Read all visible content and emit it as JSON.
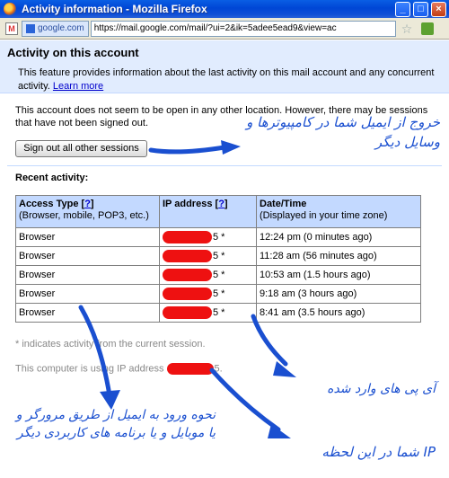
{
  "window": {
    "title": "Activity information - Mozilla Firefox",
    "buttons": {
      "minimize": "_",
      "maximize": "□",
      "close": "×"
    }
  },
  "urlbar": {
    "identity": "google.com",
    "url": "https://mail.google.com/mail/?ui=2&ik=5adee5ead9&view=ac"
  },
  "page": {
    "title": "Activity on this account",
    "intro": "This feature provides information about the last activity on this mail account and any concurrent activity.",
    "learn_more": "Learn more",
    "status": "This account does not seem to be open in any other location. However, there may be sessions that have not been signed out.",
    "signout_button": "Sign out all other sessions",
    "recent_label": "Recent activity:"
  },
  "table": {
    "headers": [
      {
        "title": "Access Type",
        "help": "?",
        "sub": "(Browser, mobile, POP3, etc.)"
      },
      {
        "title": "IP address",
        "help": "?",
        "sub": ""
      },
      {
        "title": "Date/Time",
        "help": "",
        "sub": "(Displayed in your time zone)"
      }
    ],
    "rows": [
      {
        "type": "Browser",
        "ip_suffix": "5 *",
        "time": "12:24 pm (0 minutes ago)"
      },
      {
        "type": "Browser",
        "ip_suffix": "5 *",
        "time": "11:28 am (56 minutes ago)"
      },
      {
        "type": "Browser",
        "ip_suffix": "5 *",
        "time": "10:53 am (1.5 hours ago)"
      },
      {
        "type": "Browser",
        "ip_suffix": "5 *",
        "time": "9:18 am (3 hours ago)"
      },
      {
        "type": "Browser",
        "ip_suffix": "5 *",
        "time": "8:41 am (3.5 hours ago)"
      }
    ]
  },
  "footnote": "* indicates activity from the current session.",
  "computer_ip": {
    "prefix": "This computer is using IP address",
    "suffix": "5."
  },
  "annotations": {
    "signout": "خروج از ایمیل شما در کامپیوترها و وسایل دیگر",
    "ip_used": "آی پی های وارد شده",
    "access_method": "نحوه ورود به ایمیل از طریق مرورگر و یا موبایل و یا برنامه های کاربردی دیگر",
    "current_ip": "IP شما در این لحظه"
  },
  "colors": {
    "annotation": "#1a4fd0",
    "redaction": "#ee1111",
    "header_band": "#e1ecfe",
    "table_header": "#c3d9ff"
  }
}
